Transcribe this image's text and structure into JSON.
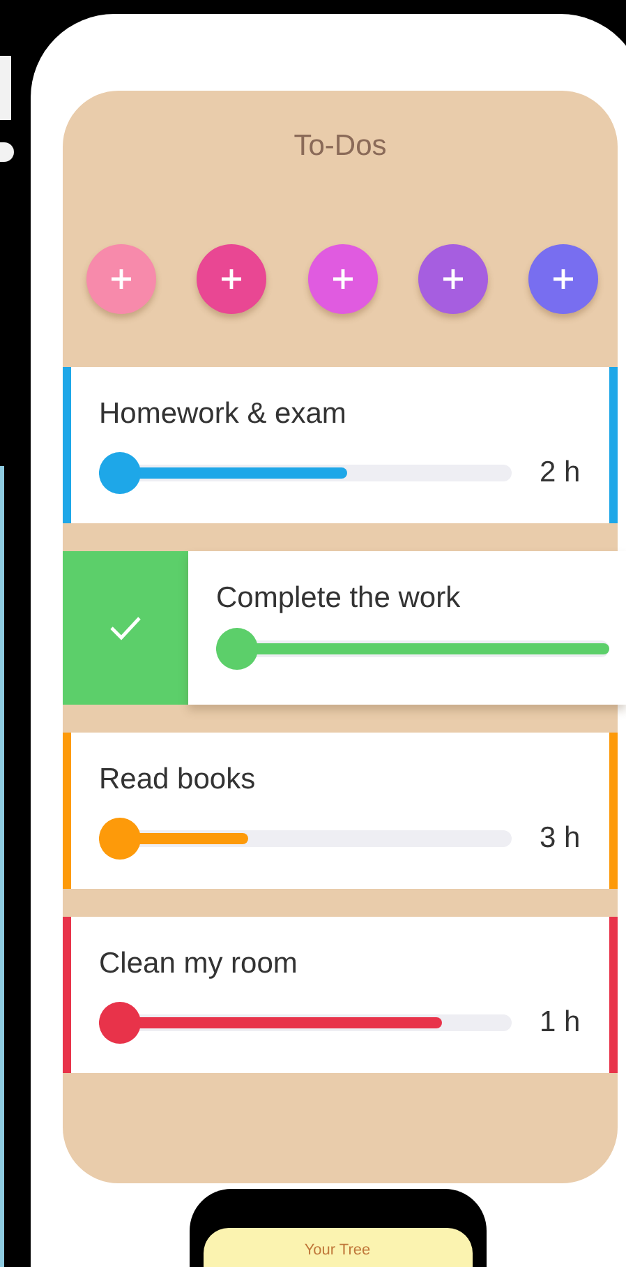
{
  "title": "To-Dos",
  "add_buttons": [
    {
      "color": "#f78aab"
    },
    {
      "color": "#e94793"
    },
    {
      "color": "#e05be0"
    },
    {
      "color": "#a65ee0"
    },
    {
      "color": "#786ef0"
    }
  ],
  "tasks": [
    {
      "title": "Homework & exam",
      "color": "#1ea7e8",
      "level": 0.6,
      "hours": "2 h",
      "completed": false
    },
    {
      "title": "Complete the work",
      "color": "#5ccf6a",
      "level": 1,
      "completed": true
    },
    {
      "title": "Read books",
      "color": "#fd9a0a",
      "level": 0.36,
      "hours": "3 h",
      "completed": false
    },
    {
      "title": "Clean my room",
      "color": "#e8334a",
      "level": 0.83,
      "hours": "1 h",
      "completed": false
    }
  ],
  "bottom_card": {
    "title": "Your Tree"
  }
}
